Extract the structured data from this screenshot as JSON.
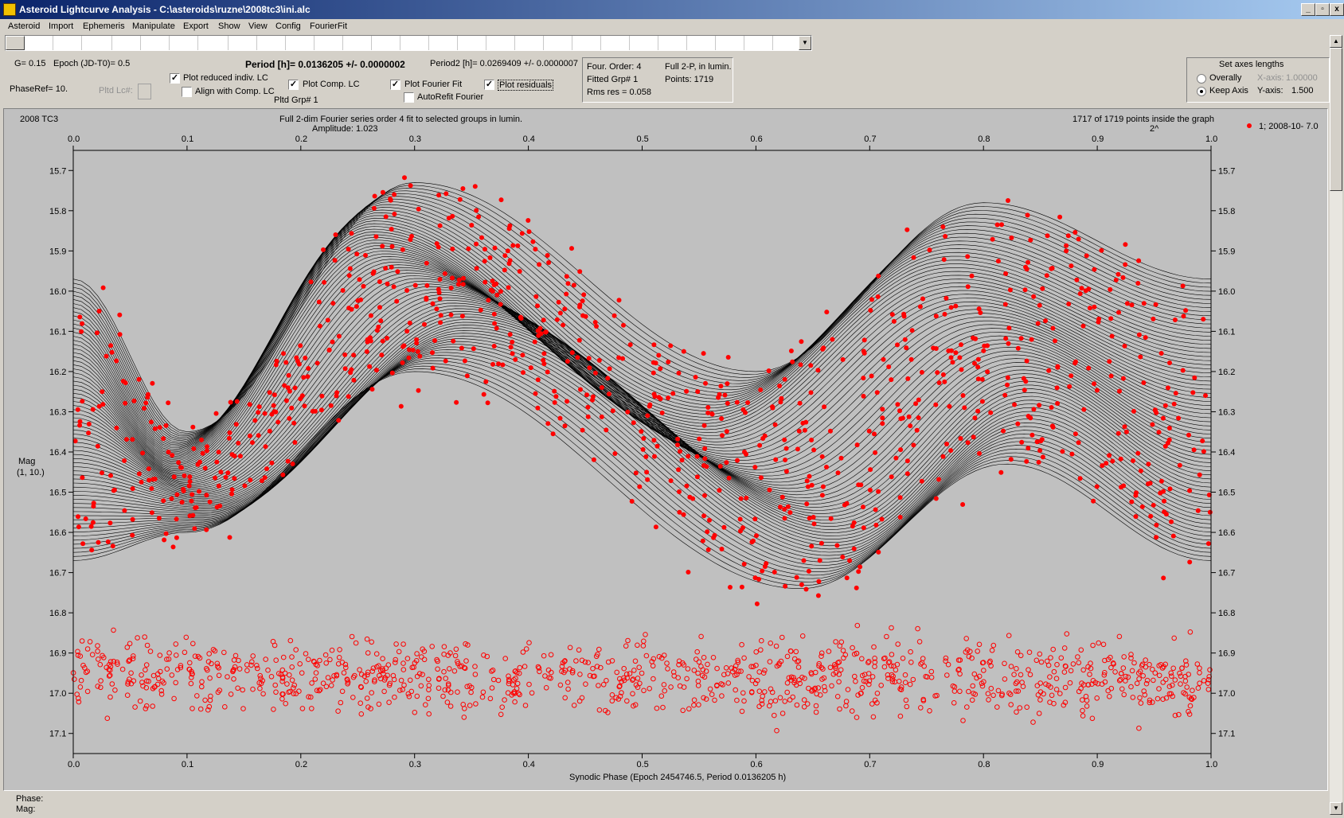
{
  "window": {
    "title": "Asteroid Lightcurve Analysis - C:\\asteroids\\ruzne\\2008tc3\\ini.alc",
    "min": "_",
    "max": "▫",
    "close": "x"
  },
  "menu": [
    "Asteroid",
    "Import",
    "Ephemeris",
    "Manipulate",
    "Export",
    "Show",
    "View",
    "Config",
    "FourierFit"
  ],
  "params": {
    "g": "G= 0.15",
    "epoch": "Epoch (JD-T0)= 0.5",
    "phaseref": "PhaseRef= 10.",
    "pltd_lc": "Pltd Lc#:",
    "period": "Period [h]= 0.0136205 +/- 0.0000002",
    "period2": "Period2 [h]= 0.0269409 +/- 0.0000007",
    "pltd_grp": "Pltd Grp#  1"
  },
  "checks": [
    {
      "label": "Plot reduced indiv. LC",
      "checked": true
    },
    {
      "label": "Align with Comp. LC",
      "checked": false
    },
    {
      "label": "Plot Comp. LC",
      "checked": true
    },
    {
      "label": "Plot Fourier Fit",
      "checked": true
    },
    {
      "label": "AutoRefit Fourier",
      "checked": false
    },
    {
      "label": "Plot residuals",
      "checked": true
    }
  ],
  "info": {
    "order": "Four. Order:  4",
    "fullp": "Full 2-P, in lumin.",
    "fitted": "Fitted Grp# 1",
    "points": "Points: 1719",
    "rms": "Rms res      = 0.058"
  },
  "axes": {
    "title": "Set axes lengths",
    "overally": "Overally",
    "keep": "Keep Axis",
    "xaxis_label": "X-axis:",
    "xaxis_value": "1.00000",
    "yaxis_label": "Y-axis:",
    "yaxis_value": "1.500"
  },
  "status": {
    "phase": "Phase:",
    "mag": "Mag:"
  },
  "colors": {
    "points": "#ff0000",
    "curves": "#000000",
    "plot_bg": "#c0c0c0"
  },
  "chart_data": {
    "type": "scatter",
    "object": "2008 TC3",
    "title": "Full 2-dim Fourier series order 4 fit to selected groups in lumin.",
    "amplitude": "Amplitude: 1.023",
    "inside": "1717 of 1719 points inside the graph",
    "corner": "2^",
    "legend": "1; 2008-10- 7.0",
    "legend_position": "top-right",
    "xlabel": "Synodic Phase (Epoch 2454746.5, Period 0.0136205 h)",
    "ylabel": "Mag",
    "ylabel2": "(1, 10.)",
    "xlim": [
      0,
      1
    ],
    "ylim": [
      15.65,
      17.15
    ],
    "y_inverted": true,
    "x_ticks": [
      "0.0",
      "0.1",
      "0.2",
      "0.3",
      "0.4",
      "0.5",
      "0.6",
      "0.7",
      "0.8",
      "0.9",
      "1.0"
    ],
    "y_ticks": [
      "15.7",
      "15.8",
      "15.9",
      "16.0",
      "16.1",
      "16.2",
      "16.3",
      "16.4",
      "16.5",
      "16.6",
      "16.7",
      "16.8",
      "16.9",
      "17.0",
      "17.1"
    ],
    "series": [
      {
        "name": "1; 2008-10- 7.0",
        "kind": "observations",
        "marker": "filled-circle",
        "count": 1719
      },
      {
        "kind": "residuals",
        "marker": "open-circle",
        "center": 16.96,
        "spread": 0.08
      }
    ],
    "fourier_envelope": {
      "upper": [
        [
          0.0,
          15.97
        ],
        [
          0.1,
          16.35
        ],
        [
          0.3,
          15.73
        ],
        [
          0.6,
          16.2
        ],
        [
          0.8,
          15.78
        ],
        [
          1.0,
          15.97
        ]
      ],
      "lower": [
        [
          0.0,
          16.67
        ],
        [
          0.1,
          16.6
        ],
        [
          0.3,
          16.2
        ],
        [
          0.64,
          16.74
        ],
        [
          0.82,
          16.43
        ],
        [
          1.0,
          16.67
        ]
      ]
    }
  }
}
